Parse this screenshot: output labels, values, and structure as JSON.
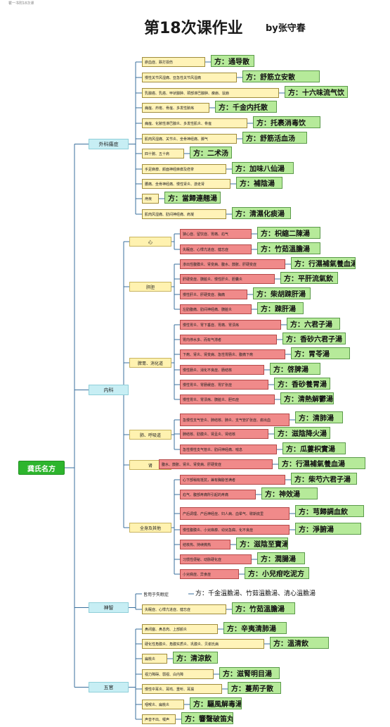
{
  "top_note": "瞿一书附18次课",
  "title": "第18次课作业",
  "author": "by张守春",
  "root": "龚氏名方",
  "sections": [
    {
      "label": "外科痛症",
      "groups": [
        {
          "label": "",
          "items": [
            {
              "symptom": "瘀血症、跌打损伤",
              "rx": "方：通导散"
            },
            {
              "symptom": "慢性关节风湿痛、亚急性关节风湿痛",
              "rx": "方：舒筋立安散"
            },
            {
              "symptom": "乳腺癌、乳癌、甲状腺肿、颈部淋巴腺肿、瘰疬、鼠疬",
              "rx": "方：十六味流气饮"
            },
            {
              "symptom": "痈疽、疖疮、骨疽、多发性脓疡",
              "rx": "方：千金内托散"
            },
            {
              "symptom": "痈疽、化脓性淋巴腺炎、多发性肌炎、骨疽",
              "rx": "方：托裹消毒饮"
            },
            {
              "symptom": "肌肉风湿痛、关节炎、坐骨神经痛、脚气",
              "rx": "方：舒筋活血汤"
            },
            {
              "symptom": "四十腕、五十肩",
              "rx": "方：二术汤"
            },
            {
              "symptom": "手足麻痹、颜面神经麻痹及痉挛",
              "rx": "方：加味八仙湯"
            },
            {
              "symptom": "腰痛、坐骨神经痛、慢性肾炎、游走肾",
              "rx": "方：補陰湯"
            },
            {
              "symptom": "痔疾",
              "rx": "方：當歸連翹湯"
            },
            {
              "symptom": "肌肉风湿痛、肋间神经痛、肩凝",
              "rx": "方：清濕化痰湯"
            }
          ]
        }
      ]
    },
    {
      "label": "内科",
      "groups": [
        {
          "label": "心",
          "items": [
            {
              "symptom": "狭心症、留饮症、胃痛、疝气",
              "rx": "方：枳縮二陳湯",
              "red": true
            },
            {
              "symptom": "失眠症、心悸亢进症、健忘症",
              "rx": "方：竹茹溫膽湯",
              "red": true
            }
          ]
        },
        {
          "label": "肝胆",
          "items": [
            {
              "symptom": "渗出性腹膜炎、肾变病、腹水、鼓胀、肝硬变症",
              "rx": "方：行濕補氣養血湯",
              "red": true
            },
            {
              "symptom": "肝硬变症、胰脏炎、慢性肝炎、胆囊炎",
              "rx": "方：平肝流氣飲",
              "red": true
            },
            {
              "symptom": "慢性肝炎、肝硬变症、胸痛",
              "rx": "方：柴胡踈肝湯",
              "red": true
            },
            {
              "symptom": "左肋腹痛、肋间神经痛、胰脏炎",
              "rx": "方：踈肝湯",
              "red": true
            }
          ]
        },
        {
          "label": "脾胃、消化道",
          "items": [
            {
              "symptom": "慢性胃炎、胃下垂症、胃痛、胃溃疡",
              "rx": "方：六君子湯",
              "red": true
            },
            {
              "symptom": "胃内停水多、而有气滞者",
              "rx": "方：香砂六君子湯",
              "red": true
            },
            {
              "symptom": "下痢、肾炎、肾变病、急性胃肠炎、腹痛下痢",
              "rx": "方：胃苓湯",
              "red": true
            },
            {
              "symptom": "慢性肠炎、消化不良症、肠结核",
              "rx": "方：啓脾湯",
              "red": true
            },
            {
              "symptom": "慢性胃炎、胃肠缓症、胃扩张症",
              "rx": "方：香砂養胃湯",
              "red": true
            },
            {
              "symptom": "慢性胃炎、胃溃疡、胰脏炎、胆石症",
              "rx": "方：清熱解鬱湯",
              "red": true
            }
          ]
        },
        {
          "label": "肺、呼吸道",
          "items": [
            {
              "symptom": "急慢性支气管炎、肺结核、肺炎、支气管扩张症、痰出血",
              "rx": "方：清肺湯",
              "red": true
            },
            {
              "symptom": "肺结核、肋膜炎、肾盂炎、肾结核",
              "rx": "方：滋陰降火湯",
              "red": true
            },
            {
              "symptom": "急性慢性支气管炎、肋间神经痛、喘息",
              "rx": "方：瓜蔞枳實湯",
              "red": true
            }
          ]
        },
        {
          "label": "肾",
          "items": [
            {
              "symptom": "腹水、鼓胀、肾炎、肾变病、肝硬变症",
              "rx": "方：行濕補氣養血湯",
              "red": true
            }
          ]
        },
        {
          "label": "全身及其他",
          "items": [
            {
              "symptom": "心下部稍有抵抗，兼有胸胁苦满者",
              "rx": "方：柴芍六君子湯",
              "red": true
            },
            {
              "symptom": "疝气、腹部疼痛所引起的疼痛",
              "rx": "方：神效湯",
              "red": true
            },
            {
              "symptom": "产后调理、产后神经症、妇人病、血晕气、歇斯底里",
              "rx": "方：芎歸調血飲",
              "red": true
            },
            {
              "symptom": "慢性腹膜炎、小兒痲痹、幼兒急痫、化不良症",
              "rx": "方：淨腑湯",
              "red": true
            },
            {
              "symptom": "结核热、持续微热",
              "rx": "方：滋陰至寶湯",
              "red": true
            },
            {
              "symptom": "习惯性便秘、动脉硬化症",
              "rx": "方：潤腸湯",
              "red": true
            },
            {
              "symptom": "小兒痫症、异食症",
              "rx": "方：小兒疳吃泥方",
              "red": true
            }
          ]
        }
      ]
    },
    {
      "label": "神智",
      "groups": [
        {
          "label": "",
          "items": [
            {
              "symptom": "皆用于失眠症",
              "rx": "方：千金溫膽湯、竹茹溫膽湯、清心溫膽湯",
              "plain": true
            },
            {
              "symptom": "失眠症、心悸亢进症、健忘症",
              "rx": "方：竹茹溫膽湯"
            }
          ]
        }
      ]
    },
    {
      "label": "五官",
      "groups": [
        {
          "label": "",
          "items": [
            {
              "symptom": "鼻闭塞、鼻息肉、上部颜炎",
              "rx": "方：辛夷清肺湯"
            },
            {
              "symptom": "硬化性角膜炎、角膜实质炎、巩膜炎、贝谢氏病",
              "rx": "方：溫清飲"
            },
            {
              "symptom": "扁桃炎",
              "rx": "方：清涼飲"
            },
            {
              "symptom": "视力障碍、弱视、白内障",
              "rx": "方：滋腎明目湯"
            },
            {
              "symptom": "慢性中耳炎、耳鸣、重听、耳漏",
              "rx": "方：蔓荊子散"
            },
            {
              "symptom": "咽喉炎、扁桃炎",
              "rx": "方：驅風解毒湯"
            },
            {
              "symptom": "声音不出、嗄声",
              "rx": "方：響聲破笛丸"
            }
          ]
        }
      ]
    }
  ]
}
